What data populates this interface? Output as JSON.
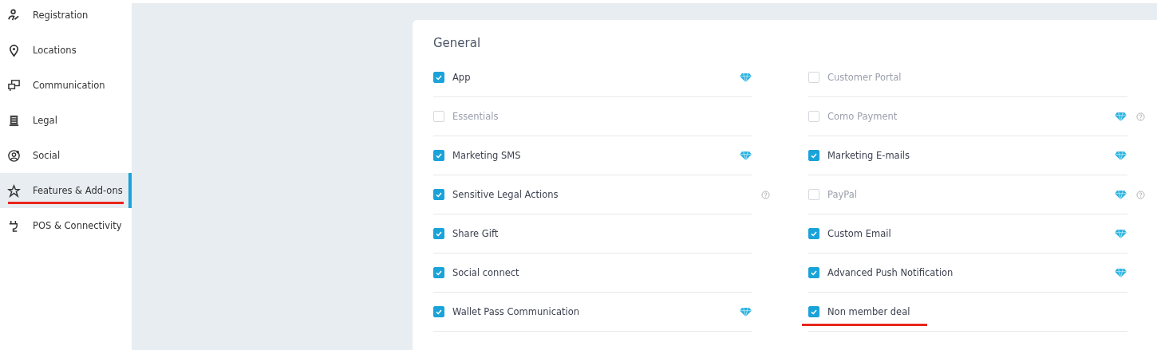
{
  "sidebar": {
    "items": [
      {
        "label": "Registration",
        "selected": false,
        "annotated": false
      },
      {
        "label": "Locations",
        "selected": false,
        "annotated": false
      },
      {
        "label": "Communication",
        "selected": false,
        "annotated": false
      },
      {
        "label": "Legal",
        "selected": false,
        "annotated": false
      },
      {
        "label": "Social",
        "selected": false,
        "annotated": false
      },
      {
        "label": "Features & Add-ons",
        "selected": true,
        "annotated": true
      },
      {
        "label": "POS & Connectivity",
        "selected": false,
        "annotated": false
      }
    ]
  },
  "section": {
    "title": "General",
    "columns": [
      [
        {
          "label": "App",
          "checked": true,
          "premium": true,
          "help": false,
          "annotated": false
        },
        {
          "label": "Essentials",
          "checked": false,
          "premium": false,
          "help": false,
          "annotated": false
        },
        {
          "label": "Marketing SMS",
          "checked": true,
          "premium": true,
          "help": false,
          "annotated": false
        },
        {
          "label": "Sensitive Legal Actions",
          "checked": true,
          "premium": false,
          "help": true,
          "annotated": false
        },
        {
          "label": "Share Gift",
          "checked": true,
          "premium": false,
          "help": false,
          "annotated": false
        },
        {
          "label": "Social connect",
          "checked": true,
          "premium": false,
          "help": false,
          "annotated": false
        },
        {
          "label": "Wallet Pass Communication",
          "checked": true,
          "premium": true,
          "help": false,
          "annotated": false
        }
      ],
      [
        {
          "label": "Customer Portal",
          "checked": false,
          "premium": false,
          "help": false,
          "annotated": false
        },
        {
          "label": "Como Payment",
          "checked": false,
          "premium": true,
          "help": true,
          "annotated": false
        },
        {
          "label": "Marketing E-mails",
          "checked": true,
          "premium": true,
          "help": false,
          "annotated": false
        },
        {
          "label": "PayPal",
          "checked": false,
          "premium": true,
          "help": true,
          "annotated": false
        },
        {
          "label": "Custom Email",
          "checked": true,
          "premium": true,
          "help": false,
          "annotated": false
        },
        {
          "label": "Advanced Push Notification",
          "checked": true,
          "premium": true,
          "help": false,
          "annotated": false
        },
        {
          "label": "Non member deal",
          "checked": true,
          "premium": false,
          "help": false,
          "annotated": true
        }
      ]
    ]
  }
}
